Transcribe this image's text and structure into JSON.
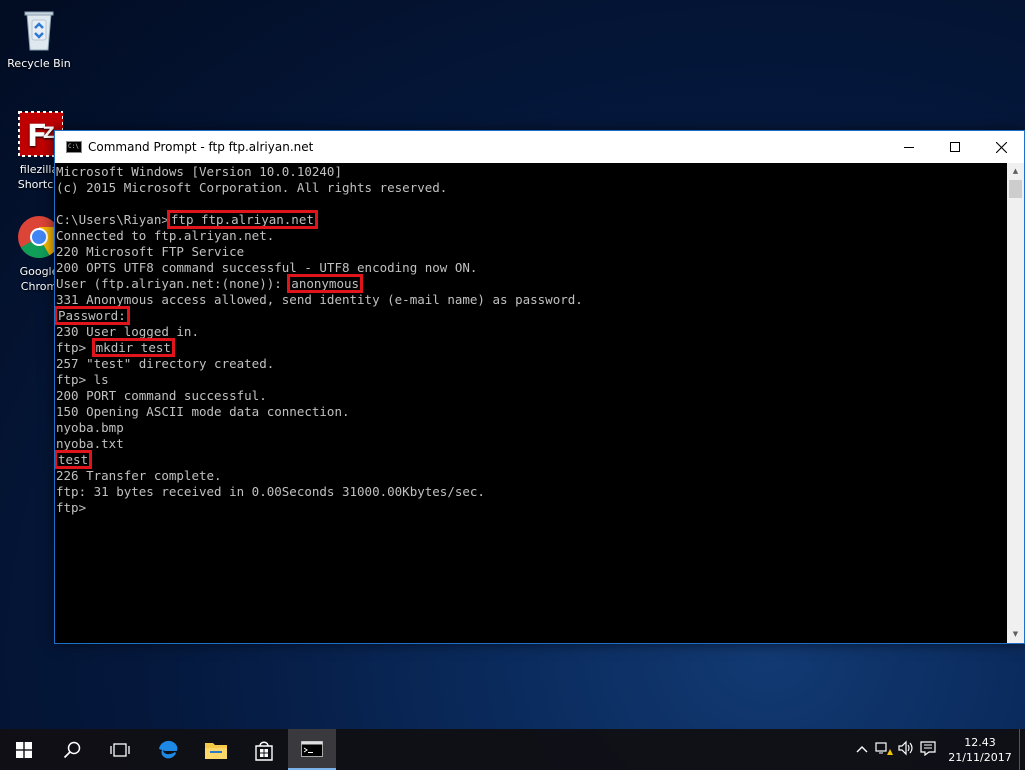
{
  "desktop": {
    "icons": [
      {
        "label_lines": [
          "Recycle Bin"
        ]
      },
      {
        "label_lines": [
          "filezilla",
          "Shortcu"
        ]
      },
      {
        "label_lines": [
          "Google",
          "Chrom"
        ]
      }
    ]
  },
  "window": {
    "title": "Command Prompt - ftp  ftp.alriyan.net",
    "accent_color": "#1f6fc9"
  },
  "console": {
    "lines": [
      {
        "text": "Microsoft Windows [Version 10.0.10240]"
      },
      {
        "text": "(c) 2015 Microsoft Corporation. All rights reserved."
      },
      {
        "text": ""
      },
      {
        "prefix": "C:\\Users\\Riyan>",
        "hl": "ftp ftp.alriyan.net",
        "suffix": ""
      },
      {
        "text": "Connected to ftp.alriyan.net."
      },
      {
        "text": "220 Microsoft FTP Service"
      },
      {
        "text": "200 OPTS UTF8 command successful - UTF8 encoding now ON."
      },
      {
        "prefix": "User (ftp.alriyan.net:(none)): ",
        "hl": "anonymous",
        "suffix": ""
      },
      {
        "text": "331 Anonymous access allowed, send identity (e-mail name) as password."
      },
      {
        "prefix": "",
        "hl": "Password:",
        "suffix": ""
      },
      {
        "text": "230 User logged in."
      },
      {
        "prefix": "ftp> ",
        "hl": "mkdir test",
        "suffix": ""
      },
      {
        "text": "257 \"test\" directory created."
      },
      {
        "text": "ftp> ls"
      },
      {
        "text": "200 PORT command successful."
      },
      {
        "text": "150 Opening ASCII mode data connection."
      },
      {
        "text": "nyoba.bmp"
      },
      {
        "text": "nyoba.txt"
      },
      {
        "prefix": "",
        "hl": "test",
        "suffix": ""
      },
      {
        "text": "226 Transfer complete."
      },
      {
        "text": "ftp: 31 bytes received in 0.00Seconds 31000.00Kbytes/sec."
      },
      {
        "text": "ftp>"
      }
    ],
    "highlight_color": "#e0141b"
  },
  "taskbar": {
    "items": [
      "start-icon",
      "search-icon",
      "task-view-icon",
      "edge-icon",
      "file-explorer-icon",
      "store-icon",
      "command-prompt-icon"
    ],
    "clock": {
      "time": "12.43",
      "date": "21/11/2017"
    }
  }
}
